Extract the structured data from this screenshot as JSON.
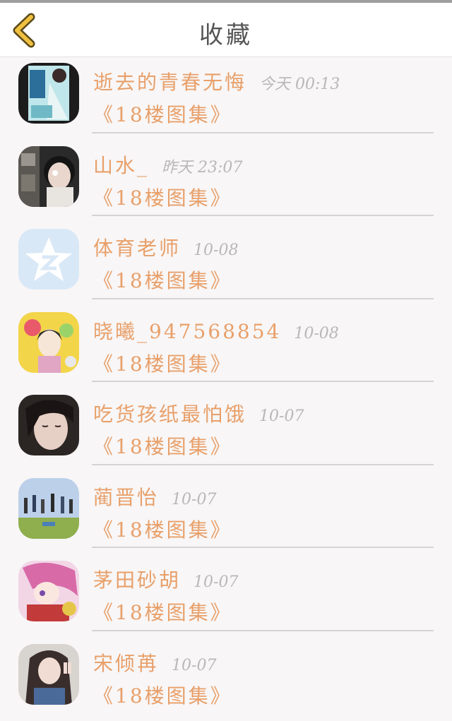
{
  "header": {
    "title": "收藏"
  },
  "colors": {
    "accent": "#e8a06a",
    "time": "#b8b8b8",
    "back_icon": "#f0c040"
  },
  "items": [
    {
      "name": "逝去的青春无悔",
      "time": "今天 00:13",
      "source": "《18楼图集》",
      "avatar": "book-cover-avatar"
    },
    {
      "name": "山水_",
      "time": "昨天 23:07",
      "source": "《18楼图集》",
      "avatar": "girl-photo-avatar"
    },
    {
      "name": "体育老师",
      "time": "10-08",
      "source": "《18楼图集》",
      "avatar": "qzone-star-avatar"
    },
    {
      "name": "晓曦_947568854",
      "time": "10-08",
      "source": "《18楼图集》",
      "avatar": "anime-yellow-avatar"
    },
    {
      "name": "吃货孩纸最怕饿",
      "time": "10-07",
      "source": "《18楼图集》",
      "avatar": "girl-closeup-avatar"
    },
    {
      "name": "蔺晋怡",
      "time": "10-07",
      "source": "《18楼图集》",
      "avatar": "jumping-group-avatar"
    },
    {
      "name": "茅田砂胡",
      "time": "10-07",
      "source": "《18楼图集》",
      "avatar": "anime-purple-avatar"
    },
    {
      "name": "宋倾苒",
      "time": "10-07",
      "source": "《18楼图集》",
      "avatar": "girl-peace-sign-avatar"
    }
  ]
}
